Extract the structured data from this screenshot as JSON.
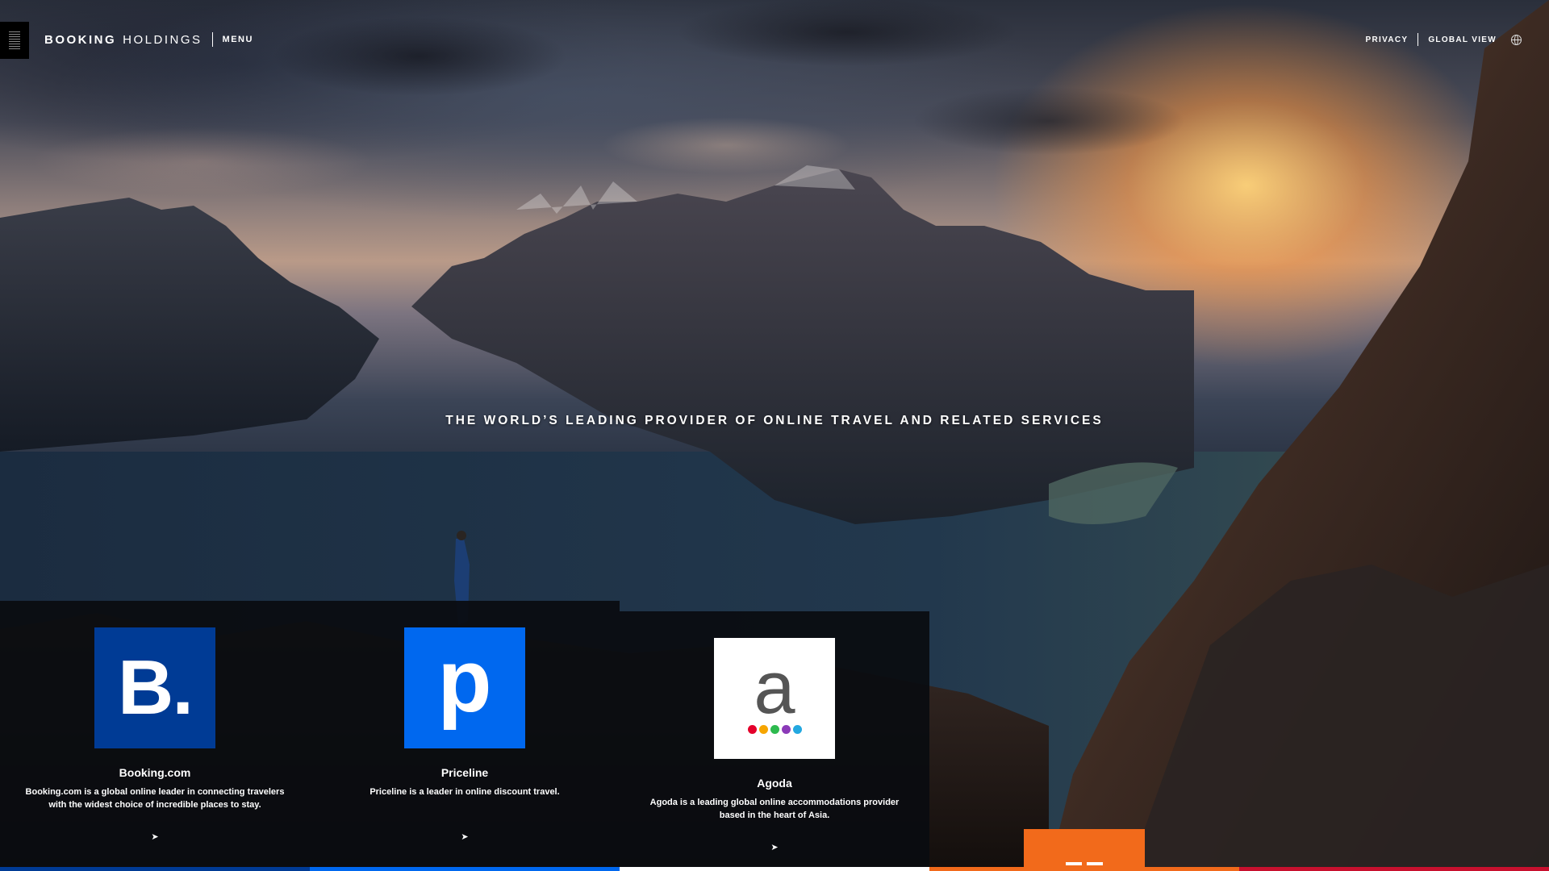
{
  "header": {
    "logo_bold": "BOOKING",
    "logo_light": "HOLDINGS",
    "menu_label": "MENU",
    "privacy_label": "PRIVACY",
    "global_view_label": "GLOBAL VIEW",
    "globe_icon": "globe-icon"
  },
  "hero": {
    "tagline": "THE WORLD’S LEADING PROVIDER OF ONLINE TRAVEL AND RELATED SERVICES"
  },
  "brands": [
    {
      "name": "Booking.com",
      "icon_text": "B.",
      "description": "Booking.com is a global online leader in connecting travelers with the widest choice of incredible places to stay.",
      "color": "#003b95",
      "arrow": "➤"
    },
    {
      "name": "Priceline",
      "icon_text": "p",
      "description": "Priceline is a leader in online discount travel.",
      "color": "#0068ef",
      "arrow": "➤"
    },
    {
      "name": "Agoda",
      "icon_text": "a",
      "description": "Agoda is a leading global online accommodations provider based in the heart of Asia.",
      "color": "#ffffff",
      "arrow": "➤"
    }
  ],
  "colors": {
    "strip": [
      "#003b95",
      "#0068ef",
      "#ffffff",
      "#f26a1b",
      "#c8102e"
    ],
    "agoda_dots": [
      "#e4002b",
      "#f6a500",
      "#2dba4e",
      "#8b3ab8",
      "#23a8e0"
    ],
    "orange_tab": "#f26a1b"
  }
}
